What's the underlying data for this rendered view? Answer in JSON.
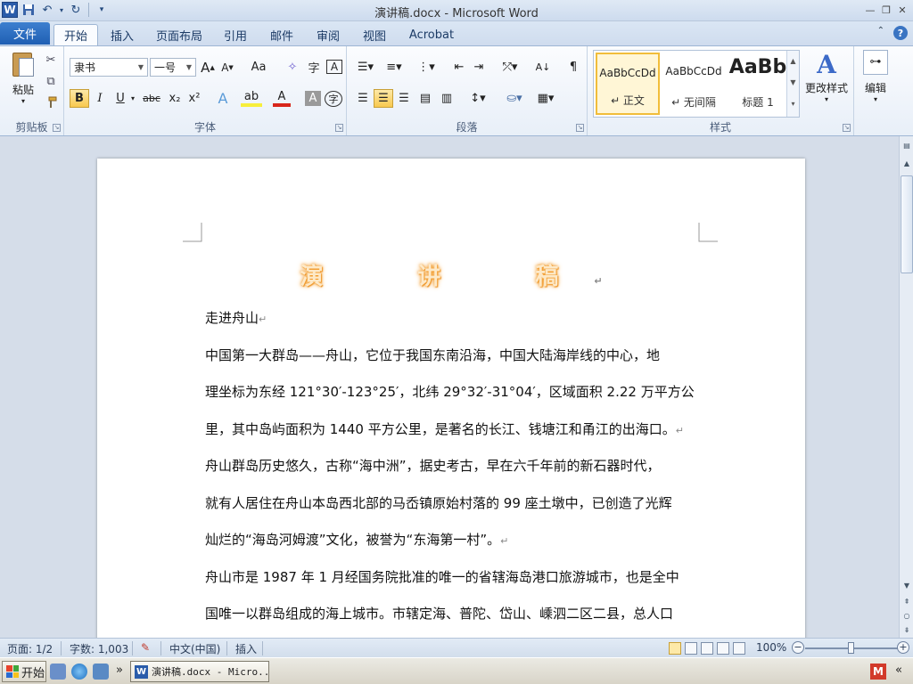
{
  "window": {
    "title": "演讲稿.docx - Microsoft Word",
    "logo": "W",
    "controls": [
      "minimize-icon",
      "restore-icon",
      "close-icon"
    ]
  },
  "ribbon_tabs": {
    "file": "文件",
    "tabs": [
      "开始",
      "插入",
      "页面布局",
      "引用",
      "邮件",
      "审阅",
      "视图",
      "Acrobat"
    ],
    "active": "开始"
  },
  "clipboard": {
    "paste_label": "粘贴",
    "group_label": "剪贴板"
  },
  "font": {
    "font_name": "隶书",
    "font_size": "一号",
    "group_label": "字体",
    "bold": "B",
    "italic": "I",
    "underline": "U",
    "strike": "abc",
    "subscript": "x₂",
    "superscript": "x²",
    "grow": "A",
    "shrink": "A",
    "aa": "Aa",
    "font_color_letter": "A",
    "highlight_letter": "ab",
    "char_shade": "A",
    "enclose": "字",
    "bold_active": true
  },
  "paragraph": {
    "group_label": "段落"
  },
  "styles": {
    "group_label": "样式",
    "items": [
      {
        "sample": "AaBbCcDd",
        "name": "↵ 正文",
        "selected": true
      },
      {
        "sample": "AaBbCcDd",
        "name": "↵ 无间隔",
        "selected": false
      },
      {
        "sample": "AaBb",
        "name": "标题 1",
        "selected": false
      }
    ],
    "change_styles_label": "更改样式"
  },
  "editing": {
    "label": "编辑"
  },
  "document": {
    "title": "演　讲　稿",
    "heading": "走进舟山",
    "lines": [
      "中国第一大群岛——舟山，它位于我国东南沿海，中国大陆海岸线的中心，地",
      "理坐标为东经 121°30′-123°25′，北纬 29°32′-31°04′，区域面积 2.22 万平方公",
      "里，其中岛屿面积为 1440 平方公里，是著名的长江、钱塘江和甬江的出海口。",
      "舟山群岛历史悠久，古称“海中洲”，据史考古，早在六千年前的新石器时代，",
      "就有人居住在舟山本岛西北部的马岙镇原始村落的 99 座土墩中，已创造了光辉",
      "灿烂的“海岛河姆渡”文化，被誉为“东海第一村”。",
      "舟山市是 1987 年 1 月经国务院批准的唯一的省辖海岛港口旅游城市，也是全中",
      "国唯一以群岛组成的海上城市。市辖定海、普陀、岱山、嵊泗二区二县，总人口"
    ],
    "paragraph_end_lines": [
      2,
      5
    ],
    "para_mark": "↵"
  },
  "status": {
    "page": "页面: 1/2",
    "words": "字数: 1,003",
    "language": "中文(中国)",
    "mode": "插入",
    "zoom": "100%",
    "zoom_fraction": 0.5
  },
  "taskbar": {
    "start": "开始",
    "task": "演讲稿.docx - Micro...",
    "chevrons": "»",
    "tray_letter": "M",
    "tray_chevron": "«"
  },
  "colors": {
    "file_tab": "#2a64b6",
    "title_glow": "#f29a28",
    "word_blue": "#2a5caa"
  }
}
